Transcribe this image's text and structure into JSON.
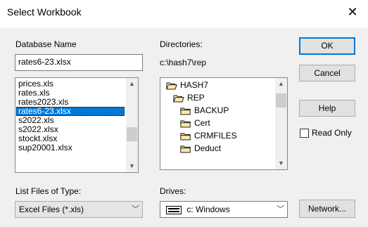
{
  "window": {
    "title": "Select Workbook",
    "close_glyph": "✕"
  },
  "database": {
    "label": "Database Name",
    "value": "rates6-23.xlsx",
    "files": [
      "prices.xls",
      "rates.xls",
      "rates2023.xls",
      "rates6-23.xlsx",
      "s2022.xls",
      "s2022.xlsx",
      "stockt.xlsx",
      "sup20001.xlsx"
    ],
    "selected_index": 3
  },
  "directories": {
    "label": "Directories:",
    "path": "c:\\hash7\\rep",
    "tree": [
      {
        "name": "HASH7",
        "state": "open"
      },
      {
        "name": "REP",
        "state": "open"
      },
      {
        "name": "BACKUP",
        "state": "closed"
      },
      {
        "name": "Cert",
        "state": "closed"
      },
      {
        "name": "CRMFILES",
        "state": "closed"
      },
      {
        "name": "Deduct",
        "state": "closed"
      }
    ]
  },
  "file_type": {
    "label": "List Files of Type:",
    "value": "Excel Files (*.xls)"
  },
  "drives": {
    "label": "Drives:",
    "value": "c: Windows"
  },
  "buttons": {
    "ok": "OK",
    "cancel": "Cancel",
    "help": "Help",
    "network": "Network..."
  },
  "read_only": {
    "label": "Read Only",
    "checked": false
  }
}
